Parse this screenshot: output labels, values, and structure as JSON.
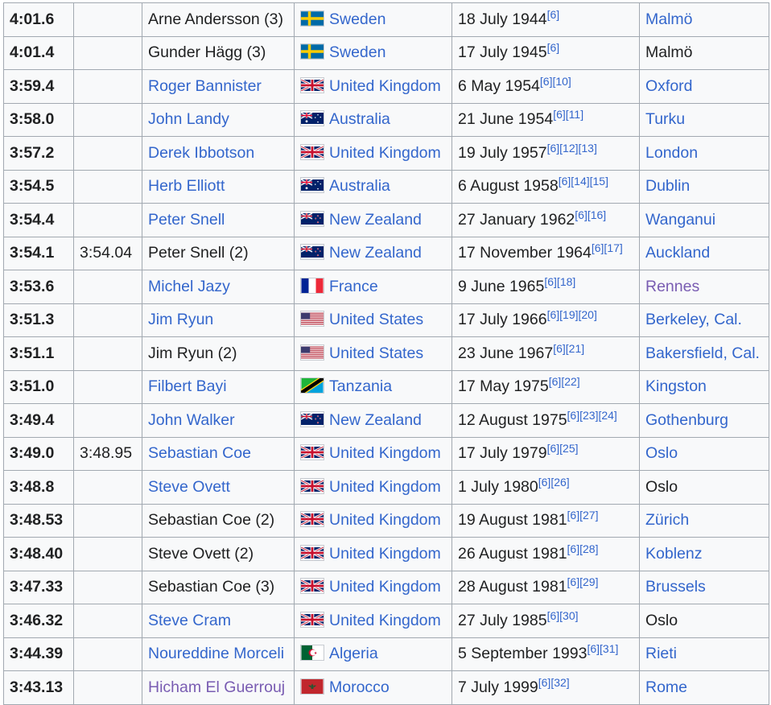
{
  "rows": [
    {
      "time": "4:01.6",
      "auto": "",
      "athlete": "Arne Andersson (3)",
      "athlete_style": "plain",
      "flag": "sweden-flag",
      "nation": "Sweden",
      "date": "18 July 1944",
      "refs": "[6]",
      "venue": "Malmö",
      "venue_style": "link"
    },
    {
      "time": "4:01.4",
      "auto": "",
      "athlete": "Gunder Hägg (3)",
      "athlete_style": "plain",
      "flag": "sweden-flag",
      "nation": "Sweden",
      "date": "17 July 1945",
      "refs": "[6]",
      "venue": "Malmö",
      "venue_style": "plain"
    },
    {
      "time": "3:59.4",
      "auto": "",
      "athlete": "Roger Bannister",
      "athlete_style": "link",
      "flag": "united-kingdom-flag",
      "nation": "United Kingdom",
      "date": "6 May 1954",
      "refs": "[6][10]",
      "venue": "Oxford",
      "venue_style": "link"
    },
    {
      "time": "3:58.0",
      "auto": "",
      "athlete": "John Landy",
      "athlete_style": "link",
      "flag": "australia-flag",
      "nation": "Australia",
      "date": "21 June 1954",
      "refs": "[6][11]",
      "venue": "Turku",
      "venue_style": "link"
    },
    {
      "time": "3:57.2",
      "auto": "",
      "athlete": "Derek Ibbotson",
      "athlete_style": "link",
      "flag": "united-kingdom-flag",
      "nation": "United Kingdom",
      "date": "19 July 1957",
      "refs": "[6][12][13]",
      "venue": "London",
      "venue_style": "link"
    },
    {
      "time": "3:54.5",
      "auto": "",
      "athlete": "Herb Elliott",
      "athlete_style": "link",
      "flag": "australia-flag",
      "nation": "Australia",
      "date": "6 August 1958",
      "refs": "[6][14][15]",
      "venue": "Dublin",
      "venue_style": "link"
    },
    {
      "time": "3:54.4",
      "auto": "",
      "athlete": "Peter Snell",
      "athlete_style": "link",
      "flag": "new-zealand-flag",
      "nation": "New Zealand",
      "date": "27 January 1962",
      "refs": "[6][16]",
      "venue": "Wanganui",
      "venue_style": "link"
    },
    {
      "time": "3:54.1",
      "auto": "3:54.04",
      "athlete": "Peter Snell (2)",
      "athlete_style": "plain",
      "flag": "new-zealand-flag",
      "nation": "New Zealand",
      "date": "17 November 1964",
      "refs": "[6][17]",
      "venue": "Auckland",
      "venue_style": "link"
    },
    {
      "time": "3:53.6",
      "auto": "",
      "athlete": "Michel Jazy",
      "athlete_style": "link",
      "flag": "france-flag",
      "nation": "France",
      "date": "9 June 1965",
      "refs": "[6][18]",
      "venue": "Rennes",
      "venue_style": "visited"
    },
    {
      "time": "3:51.3",
      "auto": "",
      "athlete": "Jim Ryun",
      "athlete_style": "link",
      "flag": "united-states-flag",
      "nation": "United States",
      "date": "17 July 1966",
      "refs": "[6][19][20]",
      "venue": "Berkeley, Cal.",
      "venue_style": "link"
    },
    {
      "time": "3:51.1",
      "auto": "",
      "athlete": "Jim Ryun (2)",
      "athlete_style": "plain",
      "flag": "united-states-flag",
      "nation": "United States",
      "date": "23 June 1967",
      "refs": "[6][21]",
      "venue": "Bakersfield, Cal.",
      "venue_style": "link"
    },
    {
      "time": "3:51.0",
      "auto": "",
      "athlete": "Filbert Bayi",
      "athlete_style": "link",
      "flag": "tanzania-flag",
      "nation": "Tanzania",
      "date": "17 May 1975",
      "refs": "[6][22]",
      "venue": "Kingston",
      "venue_style": "link"
    },
    {
      "time": "3:49.4",
      "auto": "",
      "athlete": "John Walker",
      "athlete_style": "link",
      "flag": "new-zealand-flag",
      "nation": "New Zealand",
      "date": "12 August 1975",
      "refs": "[6][23][24]",
      "venue": "Gothenburg",
      "venue_style": "link"
    },
    {
      "time": "3:49.0",
      "auto": "3:48.95",
      "athlete": "Sebastian Coe",
      "athlete_style": "link",
      "flag": "united-kingdom-flag",
      "nation": "United Kingdom",
      "date": "17 July 1979",
      "refs": "[6][25]",
      "venue": "Oslo",
      "venue_style": "link"
    },
    {
      "time": "3:48.8",
      "auto": "",
      "athlete": "Steve Ovett",
      "athlete_style": "link",
      "flag": "united-kingdom-flag",
      "nation": "United Kingdom",
      "date": "1 July 1980",
      "refs": "[6][26]",
      "venue": "Oslo",
      "venue_style": "plain"
    },
    {
      "time": "3:48.53",
      "auto": "",
      "athlete": "Sebastian Coe (2)",
      "athlete_style": "plain",
      "flag": "united-kingdom-flag",
      "nation": "United Kingdom",
      "date": "19 August 1981",
      "refs": "[6][27]",
      "venue": "Zürich",
      "venue_style": "link"
    },
    {
      "time": "3:48.40",
      "auto": "",
      "athlete": "Steve Ovett (2)",
      "athlete_style": "plain",
      "flag": "united-kingdom-flag",
      "nation": "United Kingdom",
      "date": "26 August 1981",
      "refs": "[6][28]",
      "venue": "Koblenz",
      "venue_style": "link"
    },
    {
      "time": "3:47.33",
      "auto": "",
      "athlete": "Sebastian Coe (3)",
      "athlete_style": "plain",
      "flag": "united-kingdom-flag",
      "nation": "United Kingdom",
      "date": "28 August 1981",
      "refs": "[6][29]",
      "venue": "Brussels",
      "venue_style": "link"
    },
    {
      "time": "3:46.32",
      "auto": "",
      "athlete": "Steve Cram",
      "athlete_style": "link",
      "flag": "united-kingdom-flag",
      "nation": "United Kingdom",
      "date": "27 July 1985",
      "refs": "[6][30]",
      "venue": "Oslo",
      "venue_style": "plain"
    },
    {
      "time": "3:44.39",
      "auto": "",
      "athlete": "Noureddine Morceli",
      "athlete_style": "link",
      "flag": "algeria-flag",
      "nation": "Algeria",
      "date": "5 September 1993",
      "refs": "[6][31]",
      "venue": "Rieti",
      "venue_style": "link"
    },
    {
      "time": "3:43.13",
      "auto": "",
      "athlete": "Hicham El Guerrouj",
      "athlete_style": "visited",
      "flag": "morocco-flag",
      "nation": "Morocco",
      "date": "7 July 1999",
      "refs": "[6][32]",
      "venue": "Rome",
      "venue_style": "link"
    }
  ],
  "colors": {
    "link": "#3366cc",
    "visited": "#795cb2",
    "text": "#202122",
    "border": "#a2a9b1",
    "background": "#f8f9fa"
  }
}
